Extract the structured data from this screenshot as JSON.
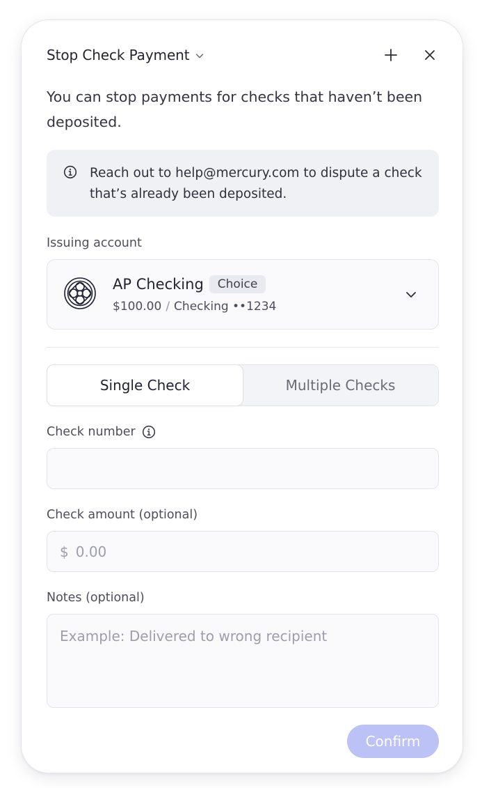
{
  "header": {
    "title": "Stop Check Payment",
    "dropdown_icon": "chevron-down-icon",
    "add_icon": "plus-icon",
    "close_icon": "close-icon"
  },
  "description": "You can stop payments for checks that haven’t been deposited.",
  "banner": {
    "icon": "info-icon",
    "text": "Reach out to help@mercury.com to dispute a check that’s already been deposited."
  },
  "issuing_account": {
    "label": "Issuing account",
    "name": "AP Checking",
    "badge": "Choice",
    "balance": "$100.00",
    "separator": "/",
    "type_and_mask": "Checking ••1234",
    "logo_icon": "ornamental-logo-icon",
    "dropdown_icon": "chevron-down-icon"
  },
  "tabs": [
    {
      "label": "Single Check",
      "active": true
    },
    {
      "label": "Multiple Checks",
      "active": false
    }
  ],
  "check_number": {
    "label": "Check number",
    "info_icon": "info-icon",
    "value": "",
    "placeholder": ""
  },
  "check_amount": {
    "label": "Check amount (optional)",
    "currency_symbol": "$",
    "value": "",
    "placeholder": "0.00"
  },
  "notes": {
    "label": "Notes (optional)",
    "value": "",
    "placeholder": "Example: Delivered to wrong recipient"
  },
  "confirm_button": {
    "label": "Confirm",
    "disabled": true
  },
  "colors": {
    "panel_bg": "#ffffff",
    "banner_bg": "#f0f1f5",
    "confirm_bg": "#bcc1f6",
    "text_primary": "#1f2030",
    "text_secondary": "#4d4e5a",
    "placeholder": "#9d9ea9"
  }
}
